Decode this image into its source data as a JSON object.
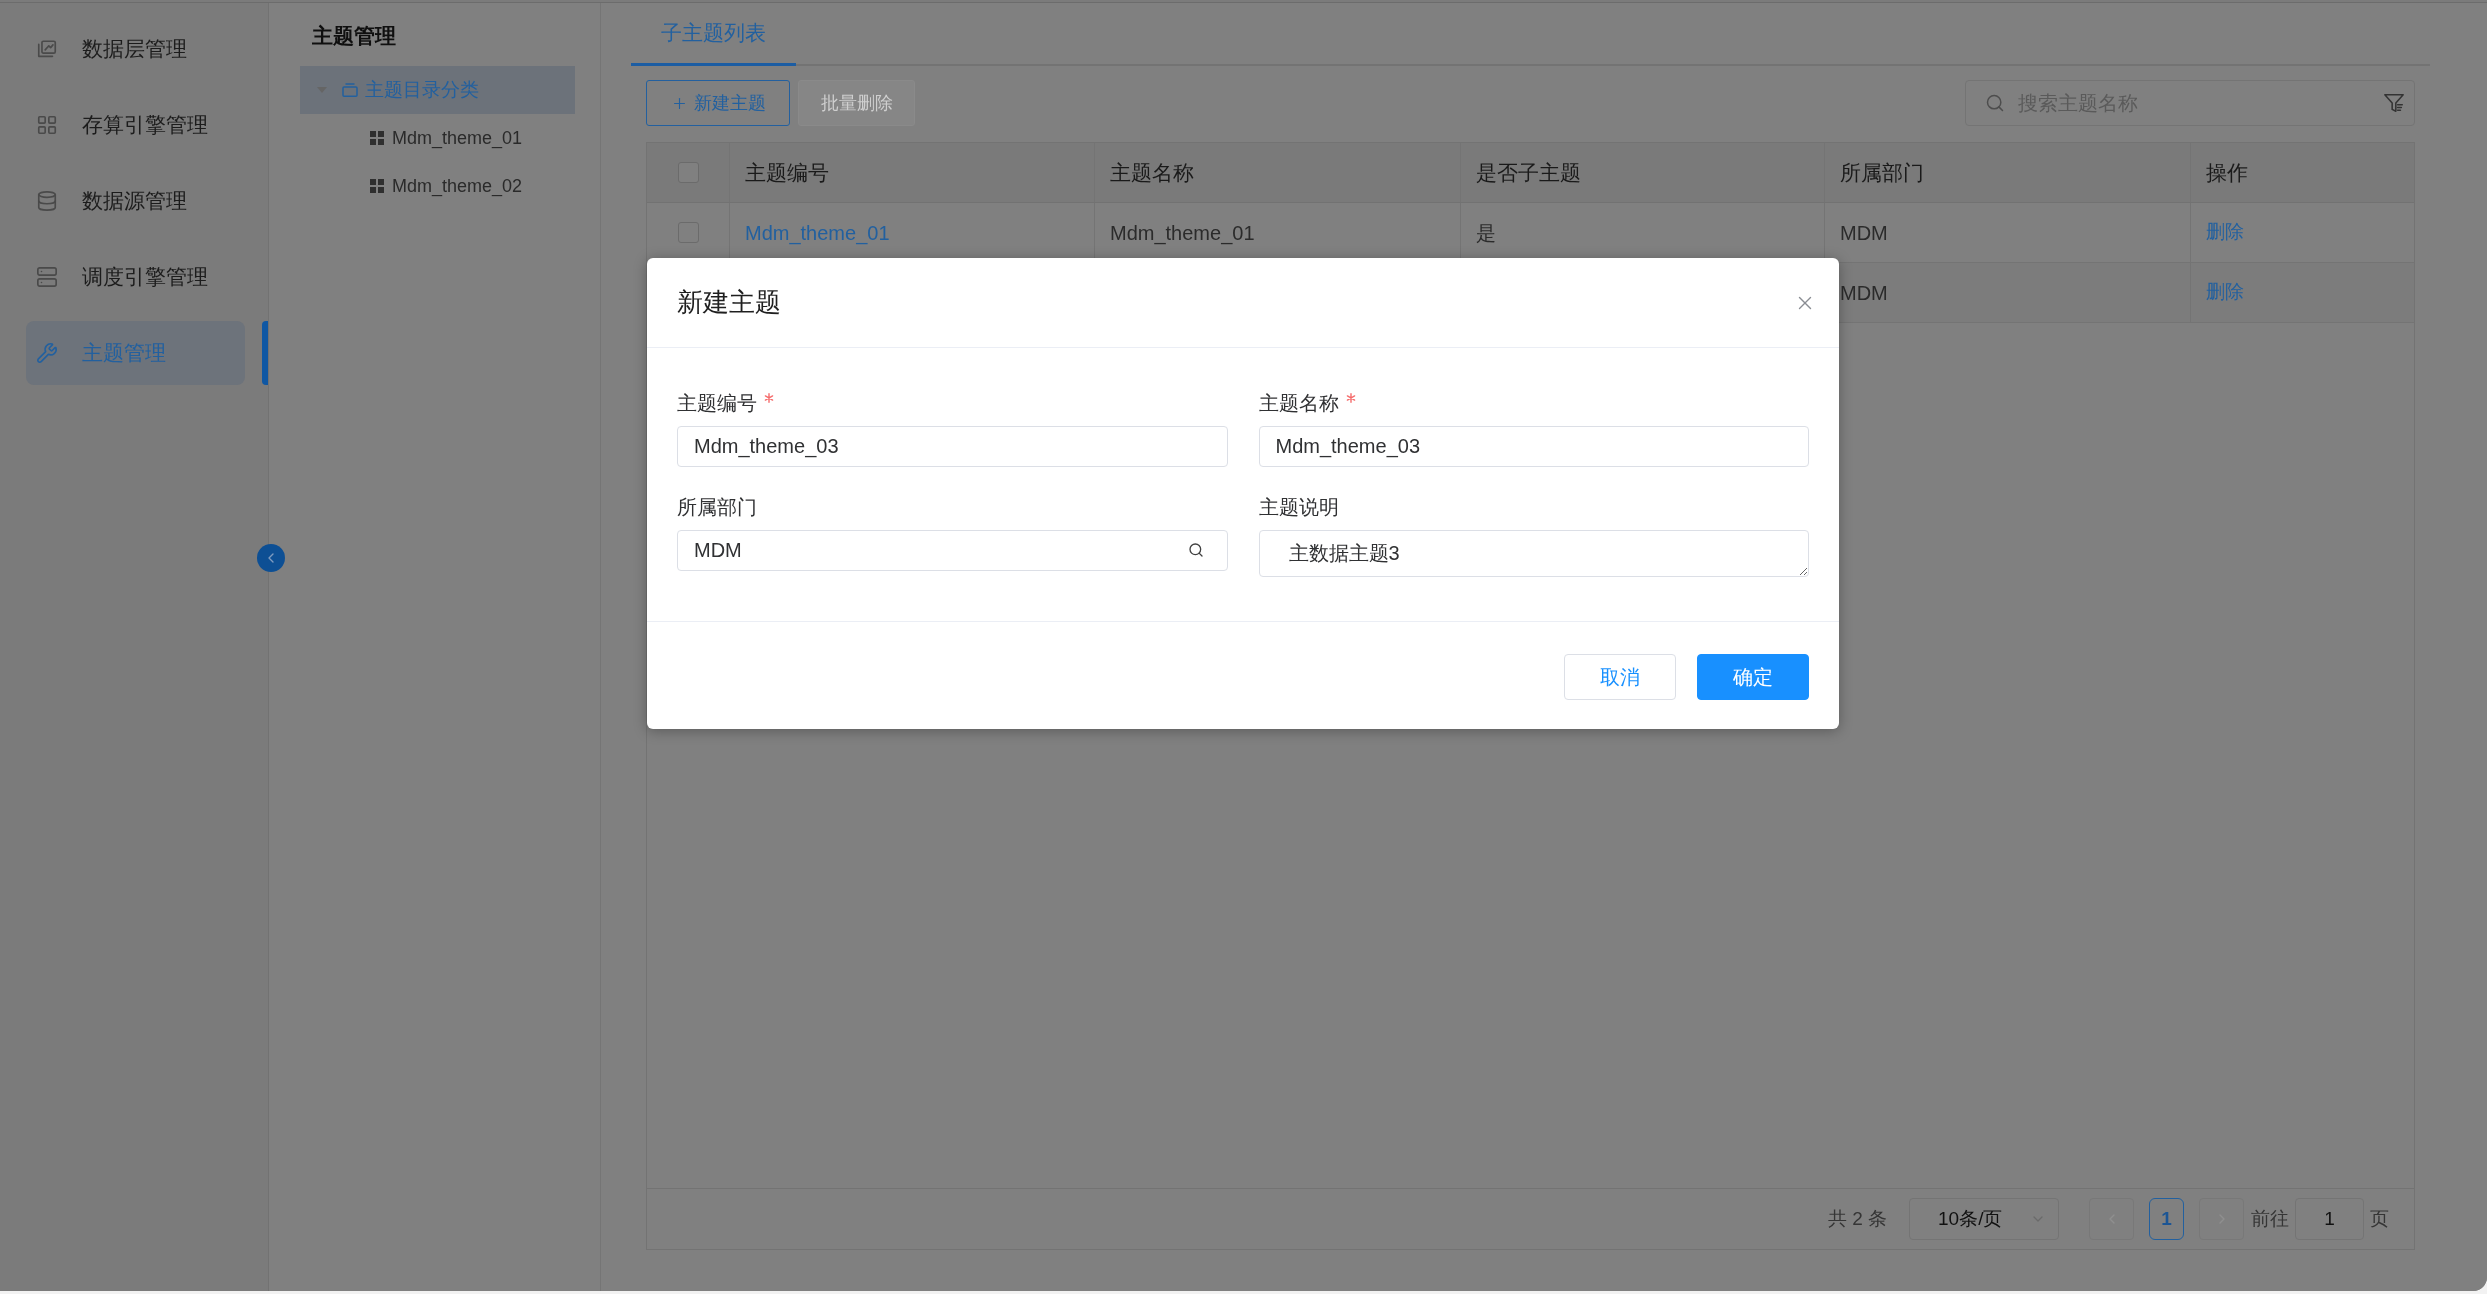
{
  "sidebar": {
    "items": [
      {
        "label": "数据层管理",
        "selected": false
      },
      {
        "label": "存算引擎管理",
        "selected": false
      },
      {
        "label": "数据源管理",
        "selected": false
      },
      {
        "label": "调度引擎管理",
        "selected": false
      },
      {
        "label": "主题管理",
        "selected": true
      }
    ]
  },
  "tree_panel": {
    "title": "主题管理",
    "nodes": [
      {
        "label": "主题目录分类",
        "expanded": true,
        "selected": true,
        "children": [
          {
            "label": "Mdm_theme_01",
            "selected": false
          },
          {
            "label": "Mdm_theme_02",
            "selected": false
          }
        ]
      }
    ]
  },
  "tabs": [
    {
      "label": "子主题列表",
      "selected": true
    }
  ],
  "toolbar": {
    "buttons": [
      {
        "label": "新建主题",
        "kind": "add",
        "disabled": false
      },
      {
        "label": "批量删除",
        "kind": "plain",
        "disabled": true
      }
    ],
    "search": {
      "placeholder": "搜索主题名称"
    }
  },
  "table": {
    "select_all": {
      "checked": false
    },
    "columns": [
      "主题编号",
      "主题名称",
      "是否子主题",
      "所属部门",
      "操作"
    ],
    "rows": [
      {
        "checked": false,
        "code": "Mdm_theme_01",
        "name": "Mdm_theme_01",
        "is_sub_theme": "是",
        "department": "MDM",
        "action": "删除"
      },
      {
        "department": "MDM",
        "action": "删除"
      }
    ]
  },
  "pagination": {
    "total": "共 2 条",
    "page_size": "10条/页",
    "prev": {
      "disabled": true
    },
    "pages": [
      {
        "label": "1",
        "selected": true
      }
    ],
    "next": {
      "disabled": true
    },
    "goto_label": "前往",
    "goto_value": "1",
    "goto_suffix": "页"
  },
  "modal": {
    "title": "新建主题",
    "fields": [
      {
        "label": "主题编号",
        "required": true,
        "kind": "text",
        "value": "Mdm_theme_03"
      },
      {
        "label": "主题名称",
        "required": true,
        "kind": "text",
        "value": "Mdm_theme_03"
      },
      {
        "label": "所属部门",
        "required": false,
        "kind": "search",
        "value": "MDM"
      },
      {
        "label": "主题说明",
        "required": false,
        "kind": "textarea",
        "value": "主数据主题3"
      }
    ],
    "buttons": [
      {
        "label": "取消",
        "kind": "default"
      },
      {
        "label": "确定",
        "kind": "primary"
      }
    ]
  }
}
